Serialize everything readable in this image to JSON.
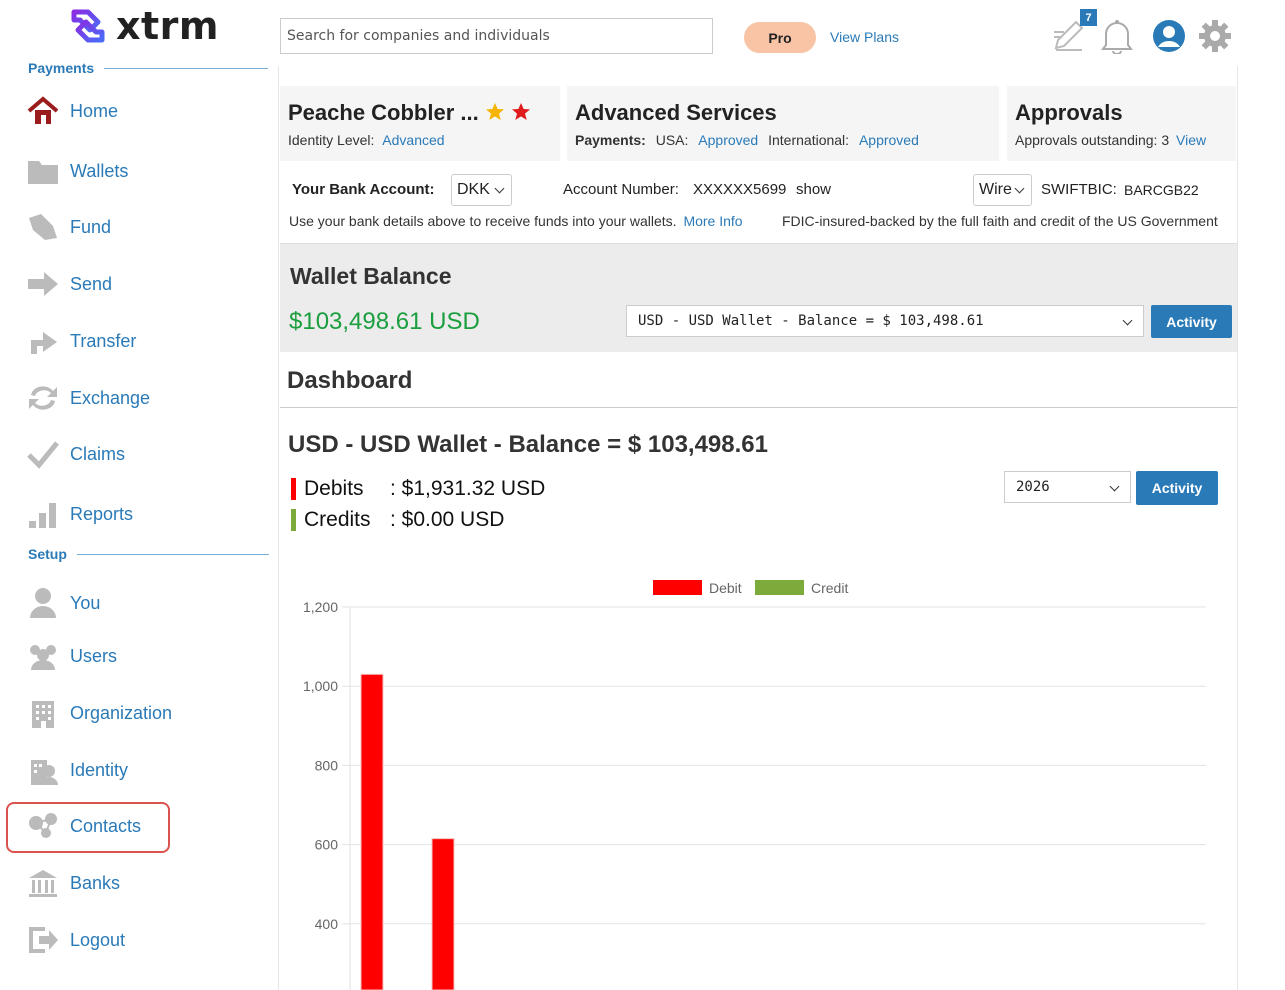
{
  "app": {
    "logo_text": "xtrm"
  },
  "sidebar": {
    "sections": {
      "payments": "Payments",
      "setup": "Setup"
    },
    "items": [
      {
        "label": "Home",
        "icon": "home-icon"
      },
      {
        "label": "Wallets",
        "icon": "folder-icon"
      },
      {
        "label": "Fund",
        "icon": "fund-icon"
      },
      {
        "label": "Send",
        "icon": "arrow-right-icon"
      },
      {
        "label": "Transfer",
        "icon": "transfer-icon"
      },
      {
        "label": "Exchange",
        "icon": "exchange-icon"
      },
      {
        "label": "Claims",
        "icon": "checkmark-icon"
      },
      {
        "label": "Reports",
        "icon": "bar-chart-icon"
      },
      {
        "label": "You",
        "icon": "person-icon"
      },
      {
        "label": "Users",
        "icon": "users-icon"
      },
      {
        "label": "Organization",
        "icon": "building-icon"
      },
      {
        "label": "Identity",
        "icon": "identity-icon"
      },
      {
        "label": "Contacts",
        "icon": "contacts-icon"
      },
      {
        "label": "Banks",
        "icon": "bank-icon"
      },
      {
        "label": "Logout",
        "icon": "logout-icon"
      }
    ]
  },
  "header": {
    "search_placeholder": "Search for companies and individuals",
    "pro_label": "Pro",
    "view_plans": "View Plans",
    "notification_badge": "7"
  },
  "cards": {
    "profile": {
      "name": "Peache Cobbler ...",
      "identity_label": "Identity Level:",
      "identity_value": "Advanced"
    },
    "services": {
      "title": "Advanced Services",
      "payments_label": "Payments:",
      "usa_label": "USA:",
      "usa_value": "Approved",
      "intl_label": "International:",
      "intl_value": "Approved"
    },
    "approvals": {
      "title": "Approvals",
      "outstanding_label": "Approvals outstanding: 3",
      "view_link": "View"
    }
  },
  "bank": {
    "account_label": "Your Bank Account:",
    "currency": "DKK",
    "account_number_label": "Account Number:",
    "account_number": "XXXXXX5699",
    "show_link": "show",
    "method": "Wire",
    "swift_label": "SWIFTBIC:",
    "swift_value": "BARCGB22",
    "instructions": "Use your bank details above to receive funds into your wallets.",
    "more_info": "More Info",
    "fdic": "FDIC-insured-backed by the full faith and credit of the US Government"
  },
  "wallet": {
    "title": "Wallet Balance",
    "amount": "$103,498.61 USD",
    "selected": "USD - USD Wallet - Balance = $ 103,498.61",
    "activity": "Activity"
  },
  "dashboard": {
    "title": "Dashboard",
    "balance_title": "USD - USD Wallet - Balance = $ 103,498.61",
    "debits_label": "Debits",
    "debits_value": ": $1,931.32 USD",
    "credits_label": "Credits",
    "credits_value": ": $0.00 USD",
    "year": "2026",
    "activity": "Activity"
  },
  "colors": {
    "accent": "#2a7ab8",
    "debit": "#ff0000",
    "credit": "#7cab3c",
    "balance_green": "#1b9e3e"
  },
  "chart_data": {
    "type": "bar",
    "legend": [
      "Debit",
      "Credit"
    ],
    "legend_position": "top",
    "grid": true,
    "ylim": [
      0,
      1200
    ],
    "yticks": [
      400,
      600,
      800,
      1000,
      1200
    ],
    "series": [
      {
        "name": "Debit",
        "color": "#ff0000",
        "values": [
          1030,
          615
        ]
      },
      {
        "name": "Credit",
        "color": "#7cab3c",
        "values": [
          0,
          0
        ]
      }
    ]
  }
}
